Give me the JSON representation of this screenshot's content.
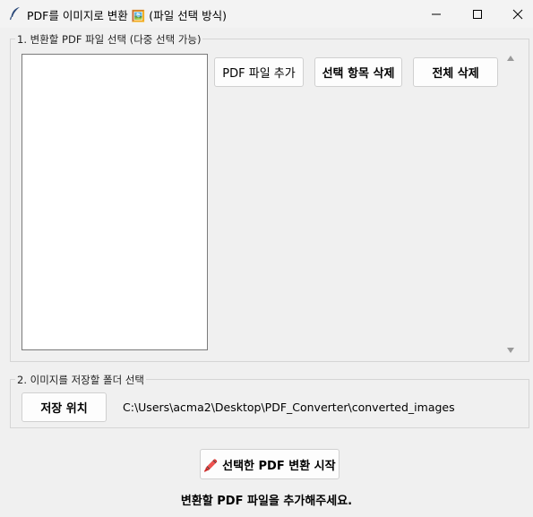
{
  "window": {
    "title": "PDF를 이미지로 변환 🖼️ (파일 선택 방식)",
    "controls": {
      "minimize": "—",
      "maximize": "☐",
      "close": "✕"
    }
  },
  "section1": {
    "label": "1. 변환할 PDF 파일 선택 (다중 선택 가능)",
    "buttons": {
      "add": "PDF 파일 추가",
      "remove_selected": "선택 항목 삭제",
      "clear_all": "전체 삭제"
    },
    "file_list": []
  },
  "section2": {
    "label": "2. 이미지를 저장할 폴더 선택",
    "save_location_button": "저장 위치",
    "output_path": "C:\\Users\\acma2\\Desktop\\PDF_Converter\\converted_images"
  },
  "convert_button": "🖍️ 선택한 PDF 변환 시작",
  "status": "변환할 PDF 파일을 추가해주세요."
}
